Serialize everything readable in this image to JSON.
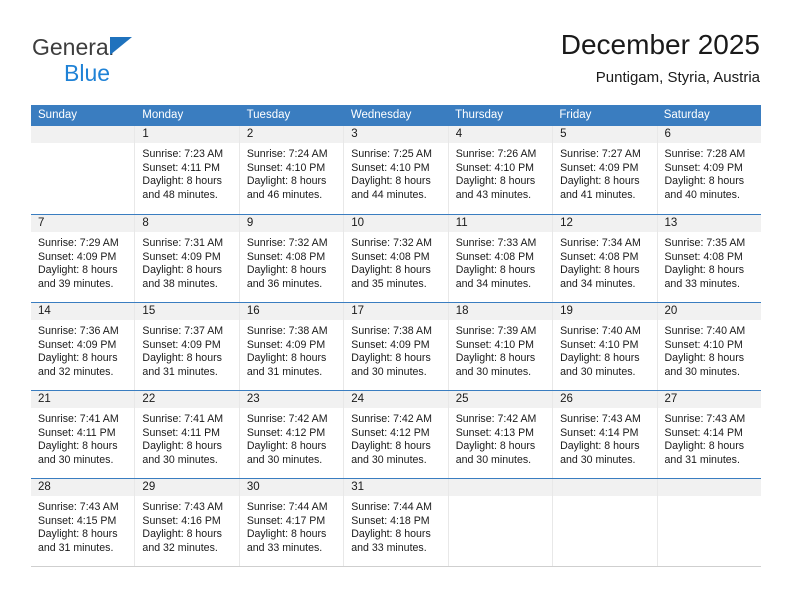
{
  "brand": {
    "line1": "General",
    "line2": "Blue",
    "triangle_color": "#1f72bd",
    "blue_text_color": "#1f82d6"
  },
  "header": {
    "title": "December 2025",
    "subtitle": "Puntigam, Styria, Austria"
  },
  "theme": {
    "header_band": "#3a7dc0",
    "day_band": "#f1f1f1",
    "week_divider": "#3a7dc0",
    "cell_divider": "#e8e8e8"
  },
  "weekdays": [
    "Sunday",
    "Monday",
    "Tuesday",
    "Wednesday",
    "Thursday",
    "Friday",
    "Saturday"
  ],
  "weeks": [
    [
      {
        "day": "",
        "l1": "",
        "l2": "",
        "l3": "",
        "l4": ""
      },
      {
        "day": "1",
        "l1": "Sunrise: 7:23 AM",
        "l2": "Sunset: 4:11 PM",
        "l3": "Daylight: 8 hours",
        "l4": "and 48 minutes."
      },
      {
        "day": "2",
        "l1": "Sunrise: 7:24 AM",
        "l2": "Sunset: 4:10 PM",
        "l3": "Daylight: 8 hours",
        "l4": "and 46 minutes."
      },
      {
        "day": "3",
        "l1": "Sunrise: 7:25 AM",
        "l2": "Sunset: 4:10 PM",
        "l3": "Daylight: 8 hours",
        "l4": "and 44 minutes."
      },
      {
        "day": "4",
        "l1": "Sunrise: 7:26 AM",
        "l2": "Sunset: 4:10 PM",
        "l3": "Daylight: 8 hours",
        "l4": "and 43 minutes."
      },
      {
        "day": "5",
        "l1": "Sunrise: 7:27 AM",
        "l2": "Sunset: 4:09 PM",
        "l3": "Daylight: 8 hours",
        "l4": "and 41 minutes."
      },
      {
        "day": "6",
        "l1": "Sunrise: 7:28 AM",
        "l2": "Sunset: 4:09 PM",
        "l3": "Daylight: 8 hours",
        "l4": "and 40 minutes."
      }
    ],
    [
      {
        "day": "7",
        "l1": "Sunrise: 7:29 AM",
        "l2": "Sunset: 4:09 PM",
        "l3": "Daylight: 8 hours",
        "l4": "and 39 minutes."
      },
      {
        "day": "8",
        "l1": "Sunrise: 7:31 AM",
        "l2": "Sunset: 4:09 PM",
        "l3": "Daylight: 8 hours",
        "l4": "and 38 minutes."
      },
      {
        "day": "9",
        "l1": "Sunrise: 7:32 AM",
        "l2": "Sunset: 4:08 PM",
        "l3": "Daylight: 8 hours",
        "l4": "and 36 minutes."
      },
      {
        "day": "10",
        "l1": "Sunrise: 7:32 AM",
        "l2": "Sunset: 4:08 PM",
        "l3": "Daylight: 8 hours",
        "l4": "and 35 minutes."
      },
      {
        "day": "11",
        "l1": "Sunrise: 7:33 AM",
        "l2": "Sunset: 4:08 PM",
        "l3": "Daylight: 8 hours",
        "l4": "and 34 minutes."
      },
      {
        "day": "12",
        "l1": "Sunrise: 7:34 AM",
        "l2": "Sunset: 4:08 PM",
        "l3": "Daylight: 8 hours",
        "l4": "and 34 minutes."
      },
      {
        "day": "13",
        "l1": "Sunrise: 7:35 AM",
        "l2": "Sunset: 4:08 PM",
        "l3": "Daylight: 8 hours",
        "l4": "and 33 minutes."
      }
    ],
    [
      {
        "day": "14",
        "l1": "Sunrise: 7:36 AM",
        "l2": "Sunset: 4:09 PM",
        "l3": "Daylight: 8 hours",
        "l4": "and 32 minutes."
      },
      {
        "day": "15",
        "l1": "Sunrise: 7:37 AM",
        "l2": "Sunset: 4:09 PM",
        "l3": "Daylight: 8 hours",
        "l4": "and 31 minutes."
      },
      {
        "day": "16",
        "l1": "Sunrise: 7:38 AM",
        "l2": "Sunset: 4:09 PM",
        "l3": "Daylight: 8 hours",
        "l4": "and 31 minutes."
      },
      {
        "day": "17",
        "l1": "Sunrise: 7:38 AM",
        "l2": "Sunset: 4:09 PM",
        "l3": "Daylight: 8 hours",
        "l4": "and 30 minutes."
      },
      {
        "day": "18",
        "l1": "Sunrise: 7:39 AM",
        "l2": "Sunset: 4:10 PM",
        "l3": "Daylight: 8 hours",
        "l4": "and 30 minutes."
      },
      {
        "day": "19",
        "l1": "Sunrise: 7:40 AM",
        "l2": "Sunset: 4:10 PM",
        "l3": "Daylight: 8 hours",
        "l4": "and 30 minutes."
      },
      {
        "day": "20",
        "l1": "Sunrise: 7:40 AM",
        "l2": "Sunset: 4:10 PM",
        "l3": "Daylight: 8 hours",
        "l4": "and 30 minutes."
      }
    ],
    [
      {
        "day": "21",
        "l1": "Sunrise: 7:41 AM",
        "l2": "Sunset: 4:11 PM",
        "l3": "Daylight: 8 hours",
        "l4": "and 30 minutes."
      },
      {
        "day": "22",
        "l1": "Sunrise: 7:41 AM",
        "l2": "Sunset: 4:11 PM",
        "l3": "Daylight: 8 hours",
        "l4": "and 30 minutes."
      },
      {
        "day": "23",
        "l1": "Sunrise: 7:42 AM",
        "l2": "Sunset: 4:12 PM",
        "l3": "Daylight: 8 hours",
        "l4": "and 30 minutes."
      },
      {
        "day": "24",
        "l1": "Sunrise: 7:42 AM",
        "l2": "Sunset: 4:12 PM",
        "l3": "Daylight: 8 hours",
        "l4": "and 30 minutes."
      },
      {
        "day": "25",
        "l1": "Sunrise: 7:42 AM",
        "l2": "Sunset: 4:13 PM",
        "l3": "Daylight: 8 hours",
        "l4": "and 30 minutes."
      },
      {
        "day": "26",
        "l1": "Sunrise: 7:43 AM",
        "l2": "Sunset: 4:14 PM",
        "l3": "Daylight: 8 hours",
        "l4": "and 30 minutes."
      },
      {
        "day": "27",
        "l1": "Sunrise: 7:43 AM",
        "l2": "Sunset: 4:14 PM",
        "l3": "Daylight: 8 hours",
        "l4": "and 31 minutes."
      }
    ],
    [
      {
        "day": "28",
        "l1": "Sunrise: 7:43 AM",
        "l2": "Sunset: 4:15 PM",
        "l3": "Daylight: 8 hours",
        "l4": "and 31 minutes."
      },
      {
        "day": "29",
        "l1": "Sunrise: 7:43 AM",
        "l2": "Sunset: 4:16 PM",
        "l3": "Daylight: 8 hours",
        "l4": "and 32 minutes."
      },
      {
        "day": "30",
        "l1": "Sunrise: 7:44 AM",
        "l2": "Sunset: 4:17 PM",
        "l3": "Daylight: 8 hours",
        "l4": "and 33 minutes."
      },
      {
        "day": "31",
        "l1": "Sunrise: 7:44 AM",
        "l2": "Sunset: 4:18 PM",
        "l3": "Daylight: 8 hours",
        "l4": "and 33 minutes."
      },
      {
        "day": "",
        "l1": "",
        "l2": "",
        "l3": "",
        "l4": ""
      },
      {
        "day": "",
        "l1": "",
        "l2": "",
        "l3": "",
        "l4": ""
      },
      {
        "day": "",
        "l1": "",
        "l2": "",
        "l3": "",
        "l4": ""
      }
    ]
  ]
}
